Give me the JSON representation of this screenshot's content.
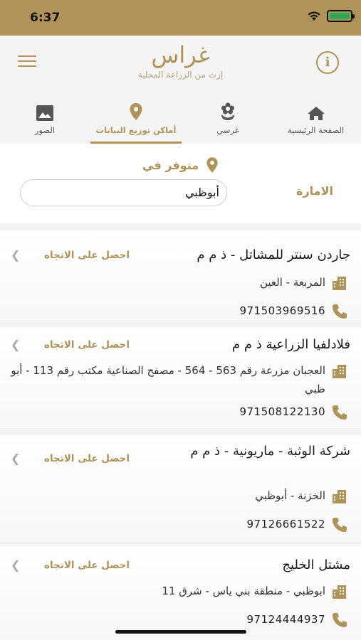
{
  "status_bar": {
    "time": "6:37"
  },
  "header": {
    "logo": "غراس",
    "tagline": "إرث من الزراعة المحلية"
  },
  "tabs": [
    {
      "label": "الصفحة الرئيسية",
      "icon": "home-icon"
    },
    {
      "label": "غرسي",
      "icon": "flower-icon"
    },
    {
      "label": "أماكن توزيع النباتات",
      "icon": "location-pin-icon",
      "active": true
    },
    {
      "label": "الصور",
      "icon": "image-icon"
    }
  ],
  "filter": {
    "available_label": "متوفر في",
    "emirate_label": "الامارة",
    "emirate_value": "أبوظبي"
  },
  "directions_label": "احصل على الاتجاه",
  "locations": [
    {
      "name": "جاردن سنتر للمشاتل - ذ م م",
      "address": "المربعة - العين",
      "phone": "971503969516"
    },
    {
      "name": "فلادلفيا الزراعية ذ م م",
      "address": "العجبان مزرعة رقم 563 - 564 - مصفح الصناعية مكتب رقم 113 - أبو ظبي",
      "phone": "971508122130"
    },
    {
      "name": "شركة الوثبة - ماريونية - ذ م م",
      "address": "الخزنة - أبوظبي",
      "phone": "97126661522"
    },
    {
      "name": "مشتل الخليج",
      "address": "ابوظبي - منطقة بني ياس - شرق 11",
      "phone": "97124444937"
    }
  ],
  "colors": {
    "brand": "#b09358",
    "status_bar": "#b09358",
    "background": "#f4f4f4"
  }
}
